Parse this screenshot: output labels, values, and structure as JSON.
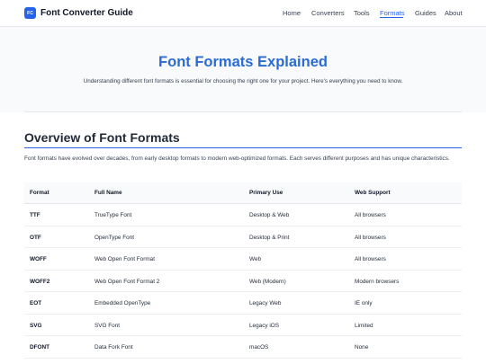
{
  "header": {
    "logo_badge": "FC",
    "site_title": "Font Converter Guide",
    "nav": [
      {
        "label": "Home"
      },
      {
        "label": "Converters"
      },
      {
        "label": "Tools"
      },
      {
        "label": "Formats",
        "active": true
      },
      {
        "label": "Guides"
      },
      {
        "label": "About"
      }
    ]
  },
  "hero": {
    "title": "Font Formats Explained",
    "subtitle": "Understanding different font formats is essential for choosing the right one for your project. Here's everything you need to know."
  },
  "overview": {
    "title": "Overview of Font Formats",
    "description": "Font formats have evolved over decades, from early desktop formats to modern web-optimized formats. Each serves different purposes and has unique characteristics."
  },
  "table": {
    "columns": [
      "Format",
      "Full Name",
      "Primary Use",
      "Web Support"
    ],
    "rows": [
      [
        "TTF",
        "TrueType Font",
        "Desktop & Web",
        "All browsers"
      ],
      [
        "OTF",
        "OpenType Font",
        "Desktop & Print",
        "All browsers"
      ],
      [
        "WOFF",
        "Web Open Font Format",
        "Web",
        "All browsers"
      ],
      [
        "WOFF2",
        "Web Open Font Format 2",
        "Web (Modern)",
        "Modern browsers"
      ],
      [
        "EOT",
        "Embedded OpenType",
        "Legacy Web",
        "IE only"
      ],
      [
        "SVG",
        "SVG Font",
        "Legacy iOS",
        "Limited"
      ],
      [
        "DFONT",
        "Data Fork Font",
        "macOS",
        "None"
      ]
    ]
  },
  "colors": {
    "accent": "#2563eb",
    "title_blue": "#2b6cd4",
    "hero_background": "#f9fafb"
  }
}
